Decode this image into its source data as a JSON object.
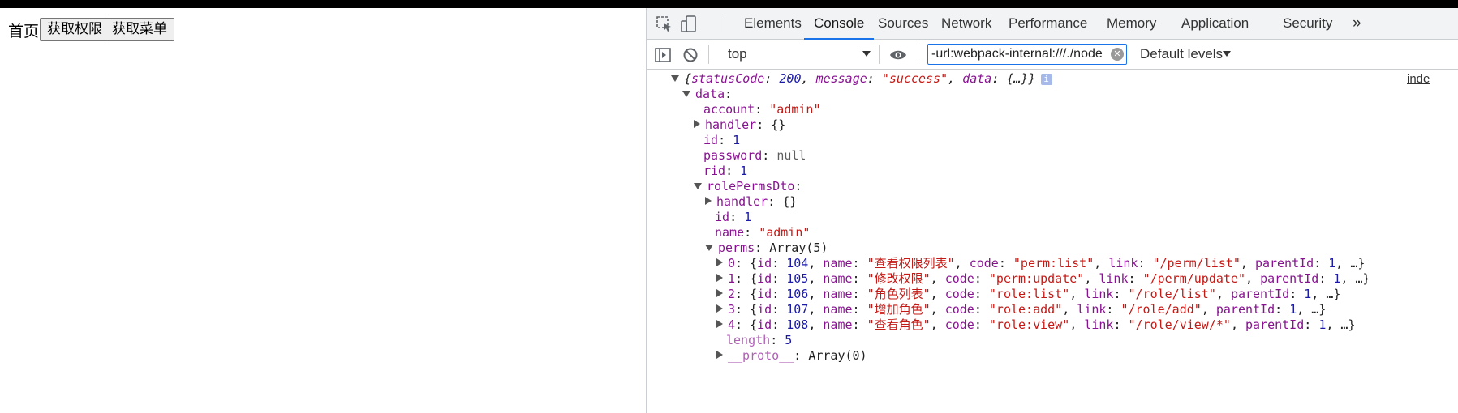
{
  "page": {
    "title": "首页",
    "buttons": [
      "获取权限",
      "获取菜单"
    ]
  },
  "devtools": {
    "tabs": [
      "Elements",
      "Console",
      "Sources",
      "Network",
      "Performance",
      "Memory",
      "Application",
      "Security"
    ],
    "active_tab": "Console",
    "more_tabs_icon": "»",
    "toolbar_icons": [
      "inspect-element-icon",
      "device-toolbar-icon"
    ],
    "console_toolbar": {
      "context": "top",
      "filter_value": "-url:webpack-internal:///./node",
      "levels_label": "Default levels",
      "icons": [
        "sidebar-toggle-icon",
        "clear-console-icon",
        "live-expression-eye-icon"
      ]
    },
    "source_link": "inde",
    "accent": "#1a73e8"
  },
  "log": {
    "root_summary": {
      "statusCode": "200",
      "message": "\"success\"",
      "data": "{…}"
    },
    "data_key": "data",
    "account": {
      "key": "account",
      "value": "\"admin\""
    },
    "handler": {
      "key": "handler",
      "value": "{}"
    },
    "id": {
      "key": "id",
      "value": "1"
    },
    "password": {
      "key": "password",
      "value": "null"
    },
    "rid": {
      "key": "rid",
      "value": "1"
    },
    "rolePermsDto": {
      "key": "rolePermsDto",
      "handler": {
        "key": "handler",
        "value": "{}"
      },
      "id": {
        "key": "id",
        "value": "1"
      },
      "name": {
        "key": "name",
        "value": "\"admin\""
      },
      "perms_key": "perms",
      "perms_type": "Array(5)",
      "perms": [
        {
          "index": "0",
          "id": "104",
          "name": "\"查看权限列表\"",
          "code": "\"perm:list\"",
          "link": "\"/perm/list\"",
          "parentId": "1"
        },
        {
          "index": "1",
          "id": "105",
          "name": "\"修改权限\"",
          "code": "\"perm:update\"",
          "link": "\"/perm/update\"",
          "parentId": "1"
        },
        {
          "index": "2",
          "id": "106",
          "name": "\"角色列表\"",
          "code": "\"role:list\"",
          "link": "\"/role/list\"",
          "parentId": "1"
        },
        {
          "index": "3",
          "id": "107",
          "name": "\"增加角色\"",
          "code": "\"role:add\"",
          "link": "\"/role/add\"",
          "parentId": "1"
        },
        {
          "index": "4",
          "id": "108",
          "name": "\"查看角色\"",
          "code": "\"role:view\"",
          "link": "\"/role/view/*\"",
          "parentId": "1"
        }
      ],
      "length": {
        "key": "length",
        "value": "5"
      },
      "proto": {
        "key": "__proto__",
        "value": "Array(0)"
      }
    }
  }
}
